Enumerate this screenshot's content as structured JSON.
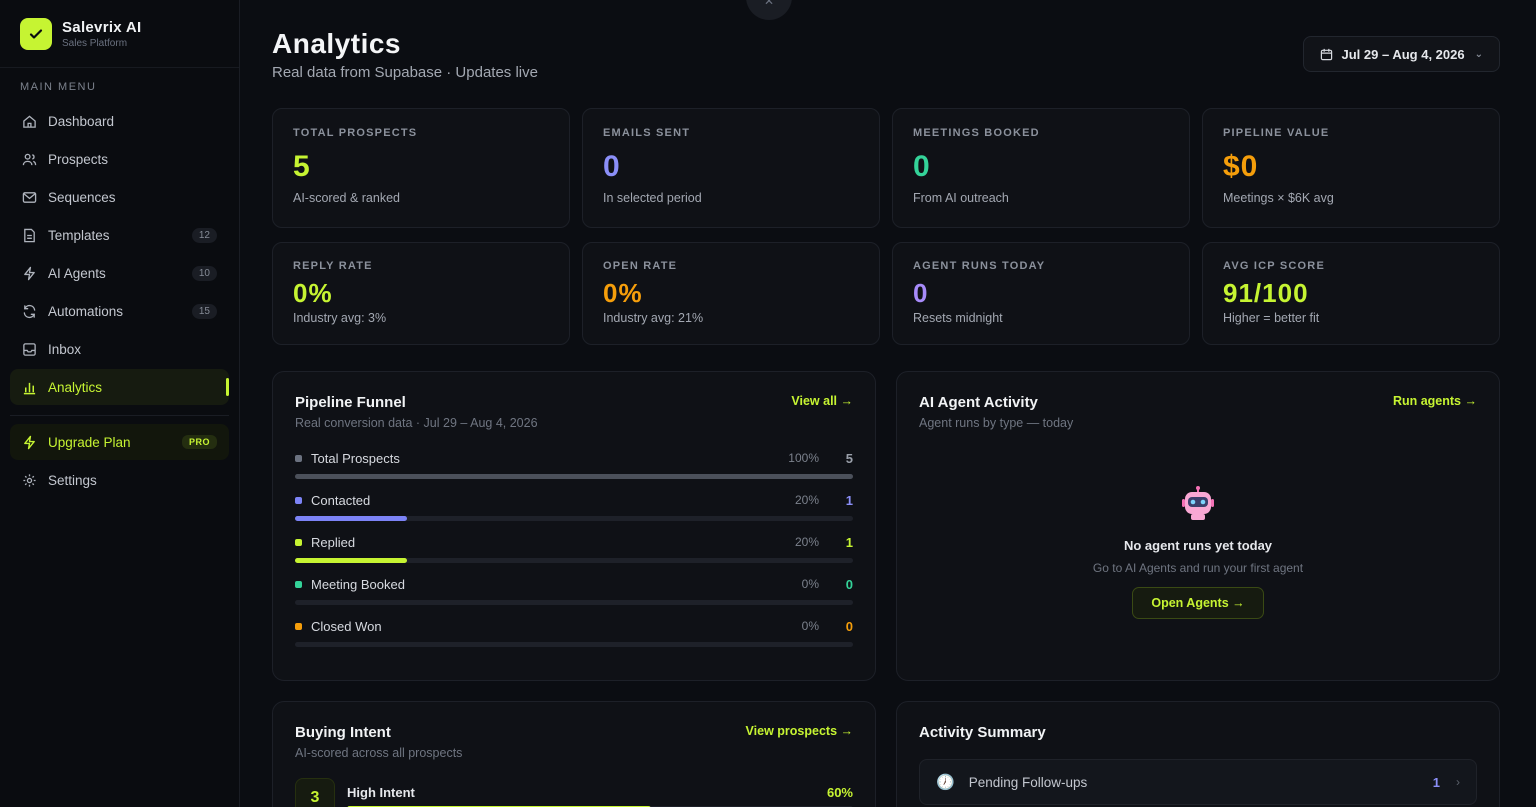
{
  "brand": {
    "name": "Salevrix AI",
    "subtitle": "Sales Platform",
    "logo_icon": "check-icon"
  },
  "sidebar": {
    "menu_title": "MAIN MENU",
    "items": [
      {
        "label": "Dashboard",
        "icon": "home-icon",
        "badge": ""
      },
      {
        "label": "Prospects",
        "icon": "users-icon",
        "badge": ""
      },
      {
        "label": "Sequences",
        "icon": "mail-icon",
        "badge": ""
      },
      {
        "label": "Templates",
        "icon": "file-icon",
        "badge": "12"
      },
      {
        "label": "AI Agents",
        "icon": "bolt-icon",
        "badge": "10"
      },
      {
        "label": "Automations",
        "icon": "refresh-icon",
        "badge": "15"
      },
      {
        "label": "Inbox",
        "icon": "inbox-icon",
        "badge": ""
      },
      {
        "label": "Analytics",
        "icon": "bar-chart-icon",
        "badge": "",
        "active": true
      }
    ],
    "upgrade": {
      "label": "Upgrade Plan",
      "badge": "PRO"
    },
    "settings": {
      "label": "Settings"
    }
  },
  "header": {
    "title": "Analytics",
    "subtitle": "Real data from Supabase · Updates live",
    "date_range": "Jul 29 – Aug 4, 2026"
  },
  "stats": [
    {
      "label": "TOTAL PROSPECTS",
      "value": "5",
      "sub": "AI-scored & ranked",
      "color": "#c6f432"
    },
    {
      "label": "EMAILS SENT",
      "value": "0",
      "sub": "In selected period",
      "color": "#8b8ff8"
    },
    {
      "label": "MEETINGS BOOKED",
      "value": "0",
      "sub": "From AI outreach",
      "color": "#34d399"
    },
    {
      "label": "PIPELINE VALUE",
      "value": "$0",
      "sub": "Meetings × $6K avg",
      "color": "#f59e0b"
    },
    {
      "label": "REPLY RATE",
      "value": "0%",
      "sub": "Industry avg: 3%",
      "color": "#c6f432"
    },
    {
      "label": "OPEN RATE",
      "value": "0%",
      "sub": "Industry avg: 21%",
      "color": "#f59e0b"
    },
    {
      "label": "AGENT RUNS TODAY",
      "value": "0",
      "sub": "Resets midnight",
      "color": "#a78bfa"
    },
    {
      "label": "AVG ICP SCORE",
      "value": "91/100",
      "sub": "Higher = better fit",
      "color": "#c6f432"
    }
  ],
  "funnel": {
    "title": "Pipeline Funnel",
    "subtitle": "Real conversion data · Jul 29 – Aug 4, 2026",
    "link": "View all →",
    "rows": [
      {
        "label": "Total Prospects",
        "pct": "100%",
        "count": "5",
        "fraction": 1.0,
        "color": "#6b7280",
        "count_color": "#9aa0aa"
      },
      {
        "label": "Contacted",
        "pct": "20%",
        "count": "1",
        "fraction": 0.2,
        "color": "#7c83f6",
        "count_color": "#8b8ff8"
      },
      {
        "label": "Replied",
        "pct": "20%",
        "count": "1",
        "fraction": 0.2,
        "color": "#c6f432",
        "count_color": "#c6f432"
      },
      {
        "label": "Meeting Booked",
        "pct": "0%",
        "count": "0",
        "fraction": 0.0,
        "color": "#34d399",
        "count_color": "#34d399"
      },
      {
        "label": "Closed Won",
        "pct": "0%",
        "count": "0",
        "fraction": 0.0,
        "color": "#f59e0b",
        "count_color": "#f59e0b"
      }
    ]
  },
  "agents": {
    "title": "AI Agent Activity",
    "subtitle": "Agent runs by type — today",
    "link": "Run agents →",
    "empty_title": "No agent runs yet today",
    "empty_sub": "Go to AI Agents and run your first agent",
    "button": "Open Agents →",
    "icon": "robot-icon"
  },
  "intent": {
    "title": "Buying Intent",
    "subtitle": "AI-scored across all prospects",
    "link": "View prospects →",
    "rows": [
      {
        "label": "High Intent",
        "pct": "60%",
        "count": "3",
        "fraction": 0.6
      }
    ]
  },
  "summary": {
    "title": "Activity Summary",
    "rows": [
      {
        "label": "Pending Follow-ups",
        "count": "1",
        "icon": "clock-icon"
      }
    ]
  }
}
